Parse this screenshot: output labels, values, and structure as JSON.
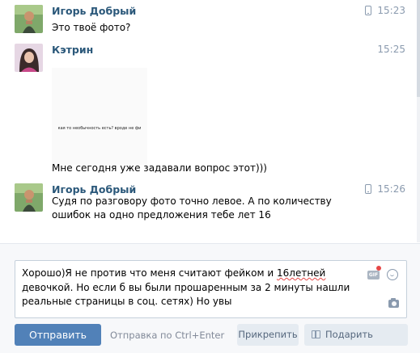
{
  "messages": [
    {
      "author": "Игорь Добрый",
      "time": "15:23",
      "mobile": true,
      "text": "Это твоё фото?"
    },
    {
      "author": "Кэтрин",
      "time": "15:25",
      "mobile": false,
      "photo_caption": "кая то необычность есть? вроде не фи",
      "text": "Мне сегодня уже задавали вопрос этот)))"
    },
    {
      "author": "Игорь Добрый",
      "time": "15:26",
      "mobile": true,
      "text_line1": "Судя по разговору фото точно левое. А по количеству",
      "text_line2": "ошибок на одно предложения тебе лет 16"
    }
  ],
  "composer": {
    "draft_part1": "Хорошо)Я не против что меня считают фейком и ",
    "draft_misspelled": "16летней",
    "draft_part2": " девочкой. Но если б вы были прошаренным за 2 минуты нашли реальные страницы в соц. сетях) Но увы",
    "gif_label": "GIF",
    "send_label": "Отправить",
    "hint": "Отправка по Ctrl+Enter",
    "attach_label": "Прикрепить",
    "gift_label": "Подарить подарок"
  },
  "colors": {
    "author": "#2b587a",
    "time": "#8a9aae",
    "send_button": "#5181b8",
    "secondary_button": "#e5ebf1"
  },
  "icons": [
    "mobile-phone-icon",
    "gif-icon",
    "notification-dot-icon",
    "sticker-icon",
    "camera-icon",
    "gift-icon"
  ]
}
